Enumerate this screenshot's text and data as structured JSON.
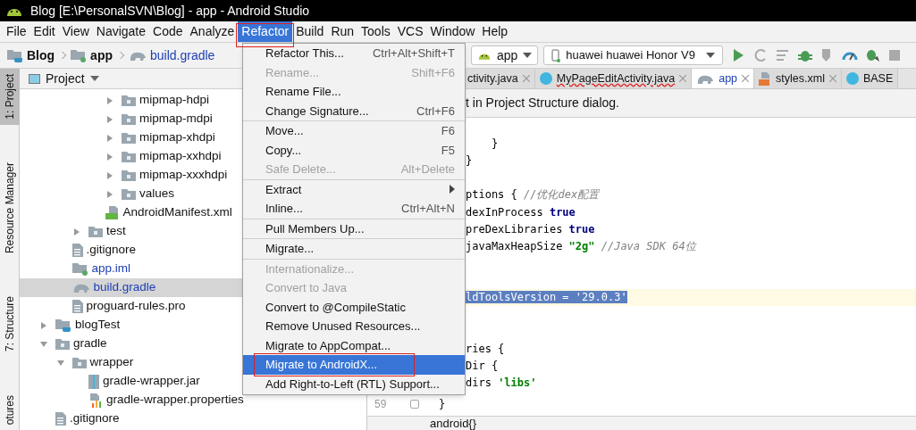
{
  "window": {
    "title": "Blog [E:\\PersonalSVN\\Blog] - app - Android Studio"
  },
  "menu_bar": [
    {
      "label": "File",
      "selected": false
    },
    {
      "label": "Edit",
      "selected": false
    },
    {
      "label": "View",
      "selected": false
    },
    {
      "label": "Navigate",
      "selected": false
    },
    {
      "label": "Code",
      "selected": false
    },
    {
      "label": "Analyze",
      "selected": false
    },
    {
      "label": "Refactor",
      "selected": true
    },
    {
      "label": "Build",
      "selected": false
    },
    {
      "label": "Run",
      "selected": false
    },
    {
      "label": "Tools",
      "selected": false
    },
    {
      "label": "VCS",
      "selected": false
    },
    {
      "label": "Window",
      "selected": false
    },
    {
      "label": "Help",
      "selected": false
    }
  ],
  "breadcrumbs": [
    {
      "label": "Blog",
      "kind": "project"
    },
    {
      "label": "app",
      "kind": "module"
    },
    {
      "label": "build.gradle",
      "kind": "gradle"
    }
  ],
  "run_config": {
    "label": "app"
  },
  "device": {
    "label": "huawei huawei Honor V9"
  },
  "toolbar_buttons": [
    {
      "kind": "run",
      "disabled": false
    },
    {
      "kind": "rerun",
      "disabled": true
    },
    {
      "kind": "logcat",
      "disabled": true
    },
    {
      "kind": "debug",
      "disabled": false
    },
    {
      "kind": "coverage",
      "disabled": true
    },
    {
      "kind": "profile",
      "disabled": false
    },
    {
      "kind": "attach",
      "disabled": false
    },
    {
      "kind": "stop",
      "disabled": true
    }
  ],
  "tool_stripe": [
    {
      "label": "1: Project",
      "selected": true
    },
    {
      "label": "Resource Manager",
      "selected": false
    },
    {
      "label": "7: Structure",
      "selected": false
    },
    {
      "label": "otures",
      "selected": false
    }
  ],
  "project_panel": {
    "title": "Project",
    "tree": [
      {
        "children": [
          {
            "children": [
              {
                "children": [
                  {
                    "children": [
                      {
                        "label": "mipmap-hdpi",
                        "kind": "folder",
                        "expanded": false,
                        "selected": false,
                        "modified": false
                      },
                      {
                        "label": "mipmap-mdpi",
                        "kind": "folder",
                        "expanded": false,
                        "selected": false,
                        "modified": false
                      },
                      {
                        "label": "mipmap-xhdpi",
                        "kind": "folder",
                        "expanded": false,
                        "selected": false,
                        "modified": false
                      },
                      {
                        "label": "mipmap-xxhdpi",
                        "kind": "folder",
                        "expanded": false,
                        "selected": false,
                        "modified": false
                      },
                      {
                        "label": "mipmap-xxxhdpi",
                        "kind": "folder",
                        "expanded": false,
                        "selected": false,
                        "modified": false
                      },
                      {
                        "label": "values",
                        "kind": "folder",
                        "expanded": false,
                        "selected": false,
                        "modified": false
                      }
                    ]
                  },
                  {
                    "label": "AndroidManifest.xml",
                    "kind": "manifest",
                    "selected": false,
                    "modified": false
                  }
                ]
              },
              {
                "label": "test",
                "kind": "folder",
                "expanded": false,
                "selected": false,
                "modified": false
              }
            ]
          },
          {
            "label": ".gitignore",
            "kind": "file",
            "selected": false,
            "modified": false
          },
          {
            "label": "app.iml",
            "kind": "iml",
            "selected": false,
            "modified": true
          },
          {
            "label": "build.gradle",
            "kind": "gradle",
            "selected": true,
            "modified": true
          },
          {
            "label": "proguard-rules.pro",
            "kind": "file",
            "selected": false,
            "modified": false
          }
        ]
      },
      {
        "label": "blogTest",
        "kind": "module",
        "expanded": false,
        "selected": false,
        "modified": false
      },
      {
        "label": "gradle",
        "kind": "folder",
        "expanded": true,
        "selected": false,
        "modified": false,
        "children": [
          {
            "label": "wrapper",
            "kind": "folder",
            "expanded": true,
            "selected": false,
            "modified": false,
            "children": [
              {
                "label": "gradle-wrapper.jar",
                "kind": "jar",
                "selected": false,
                "modified": false
              },
              {
                "label": "gradle-wrapper.properties",
                "kind": "properties",
                "selected": false,
                "modified": false
              }
            ]
          }
        ]
      },
      {
        "label": ".gitignore",
        "kind": "file",
        "selected": false,
        "modified": false
      }
    ]
  },
  "editor_tabs": [
    {
      "label": "ctivity.java",
      "selected": false,
      "error": false
    },
    {
      "label": "MyPageEditActivity.java",
      "kind": "class",
      "selected": false,
      "error": true
    },
    {
      "label": "app",
      "kind": "gradle",
      "selected": true,
      "error": false
    },
    {
      "label": "styles.xml",
      "kind": "xml",
      "selected": false,
      "error": false
    },
    {
      "label": "BASE",
      "kind": "class",
      "selected": false,
      "error": false
    }
  ],
  "banner": {
    "text": "t in Project Structure dialog."
  },
  "code_lines": [
    {
      "current": false
    },
    {
      "current": false,
      "segments": [
        {
          "kind": "plain",
          "text": "    }"
        }
      ]
    },
    {
      "current": false,
      "segments": [
        {
          "kind": "plain",
          "text": "}"
        }
      ]
    },
    {
      "current": false
    },
    {
      "current": false,
      "segments": [
        {
          "kind": "plain",
          "text": "ptions { "
        },
        {
          "kind": "comment",
          "text": "//优化dex配置"
        }
      ]
    },
    {
      "current": false,
      "segments": [
        {
          "kind": "plain",
          "text": "dexInProcess "
        },
        {
          "kind": "keyword",
          "text": "true"
        }
      ]
    },
    {
      "current": false,
      "segments": [
        {
          "kind": "plain",
          "text": "preDexLibraries "
        },
        {
          "kind": "keyword",
          "text": "true"
        }
      ]
    },
    {
      "current": false,
      "segments": [
        {
          "kind": "plain",
          "text": "javaMaxHeapSize "
        },
        {
          "kind": "string",
          "text": "\"2g\""
        },
        {
          "kind": "comment",
          "text": " //Java SDK 64位"
        }
      ]
    },
    {
      "current": false
    },
    {
      "current": false
    },
    {
      "current": true,
      "segments": [
        {
          "kind": "selection",
          "text": "ldToolsVersion = '29.0.3'"
        }
      ]
    },
    {
      "current": false
    },
    {
      "current": false
    },
    {
      "current": false,
      "segments": [
        {
          "kind": "plain",
          "text": "ries {"
        }
      ]
    },
    {
      "current": false,
      "segments": [
        {
          "kind": "plain",
          "text": "Dir {"
        }
      ]
    },
    {
      "current": false,
      "segments": [
        {
          "kind": "plain",
          "text": "dirs "
        },
        {
          "kind": "string",
          "text": "'libs'"
        }
      ]
    }
  ],
  "gutter_line": {
    "number": "59",
    "text": "}"
  },
  "bottom_bar": {
    "text": "android{}"
  },
  "refactor_menu": {
    "groups": [
      [
        {
          "label": "Refactor This...",
          "shortcut": "Ctrl+Alt+Shift+T",
          "disabled": false,
          "selected": false,
          "submenu": false
        },
        {
          "label": "Rename...",
          "shortcut": "Shift+F6",
          "disabled": true,
          "selected": false,
          "submenu": false
        },
        {
          "label": "Rename File...",
          "disabled": false,
          "selected": false,
          "submenu": false
        },
        {
          "label": "Change Signature...",
          "shortcut": "Ctrl+F6",
          "disabled": false,
          "selected": false,
          "submenu": false
        }
      ],
      [
        {
          "label": "Move...",
          "shortcut": "F6",
          "disabled": false,
          "selected": false,
          "submenu": false
        },
        {
          "label": "Copy...",
          "shortcut": "F5",
          "disabled": false,
          "selected": false,
          "submenu": false
        },
        {
          "label": "Safe Delete...",
          "shortcut": "Alt+Delete",
          "disabled": true,
          "selected": false,
          "submenu": false
        }
      ],
      [
        {
          "label": "Extract",
          "disabled": false,
          "selected": false,
          "submenu": true
        },
        {
          "label": "Inline...",
          "shortcut": "Ctrl+Alt+N",
          "disabled": false,
          "selected": false,
          "submenu": false
        }
      ],
      [
        {
          "label": "Pull Members Up...",
          "disabled": false,
          "selected": false,
          "submenu": false
        }
      ],
      [
        {
          "label": "Migrate...",
          "disabled": false,
          "selected": false,
          "submenu": false
        }
      ],
      [
        {
          "label": "Internationalize...",
          "disabled": true,
          "selected": false,
          "submenu": false
        },
        {
          "label": "Convert to Java",
          "disabled": true,
          "selected": false,
          "submenu": false
        },
        {
          "label": "Convert to @CompileStatic",
          "disabled": false,
          "selected": false,
          "submenu": false
        },
        {
          "label": "Remove Unused Resources...",
          "disabled": false,
          "selected": false,
          "submenu": false
        },
        {
          "label": "Migrate to AppCompat...",
          "disabled": false,
          "selected": false,
          "submenu": false
        },
        {
          "label": "Migrate to AndroidX...",
          "disabled": false,
          "selected": true,
          "submenu": false
        },
        {
          "label": "Add Right-to-Left (RTL) Support...",
          "disabled": false,
          "selected": false,
          "submenu": false
        }
      ]
    ]
  },
  "highlight_frames": {
    "around_menu_title": true,
    "around_menu_entry": true
  }
}
